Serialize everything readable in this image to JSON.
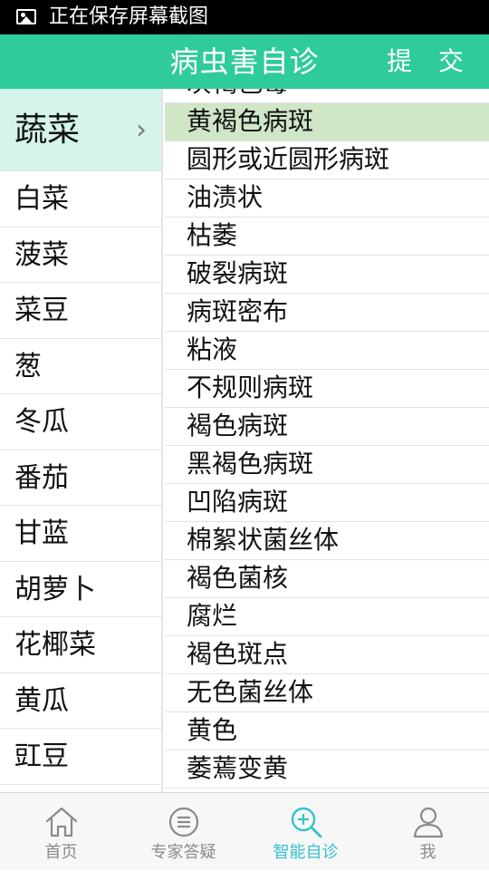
{
  "status_bar": {
    "text": "正在保存屏幕截图",
    "icon": "image-icon"
  },
  "header": {
    "title": "病虫害自诊",
    "submit_label": "提 交",
    "color": "#2fcb9a"
  },
  "category": {
    "label": "蔬菜",
    "chevron": "›"
  },
  "vegetables": [
    "白菜",
    "菠菜",
    "菜豆",
    "葱",
    "冬瓜",
    "番茄",
    "甘蓝",
    "胡萝卜",
    "花椰菜",
    "黄瓜",
    "豇豆"
  ],
  "symptoms": [
    "灰褐色霉",
    "黄褐色病斑",
    "圆形或近圆形病斑",
    "油渍状",
    "枯萎",
    "破裂病斑",
    "病斑密布",
    "粘液",
    "不规则病斑",
    "褐色病斑",
    "黑褐色病斑",
    "凹陷病斑",
    "棉絮状菌丝体",
    "褐色菌核",
    "腐烂",
    "褐色斑点",
    "无色菌丝体",
    "黄色",
    "萎蔫变黄"
  ],
  "selected_symptom": "黄褐色病斑",
  "tabs": [
    {
      "label": "首页",
      "icon": "home-icon",
      "active": false
    },
    {
      "label": "专家答疑",
      "icon": "chat-icon",
      "active": false
    },
    {
      "label": "智能自诊",
      "icon": "diagnosis-search-icon",
      "active": true
    },
    {
      "label": "我",
      "icon": "user-icon",
      "active": false
    }
  ],
  "colors": {
    "active_tab": "#35c1cf",
    "selected_row": "#cfe6c7",
    "category_bg": "#d5f5ec"
  }
}
